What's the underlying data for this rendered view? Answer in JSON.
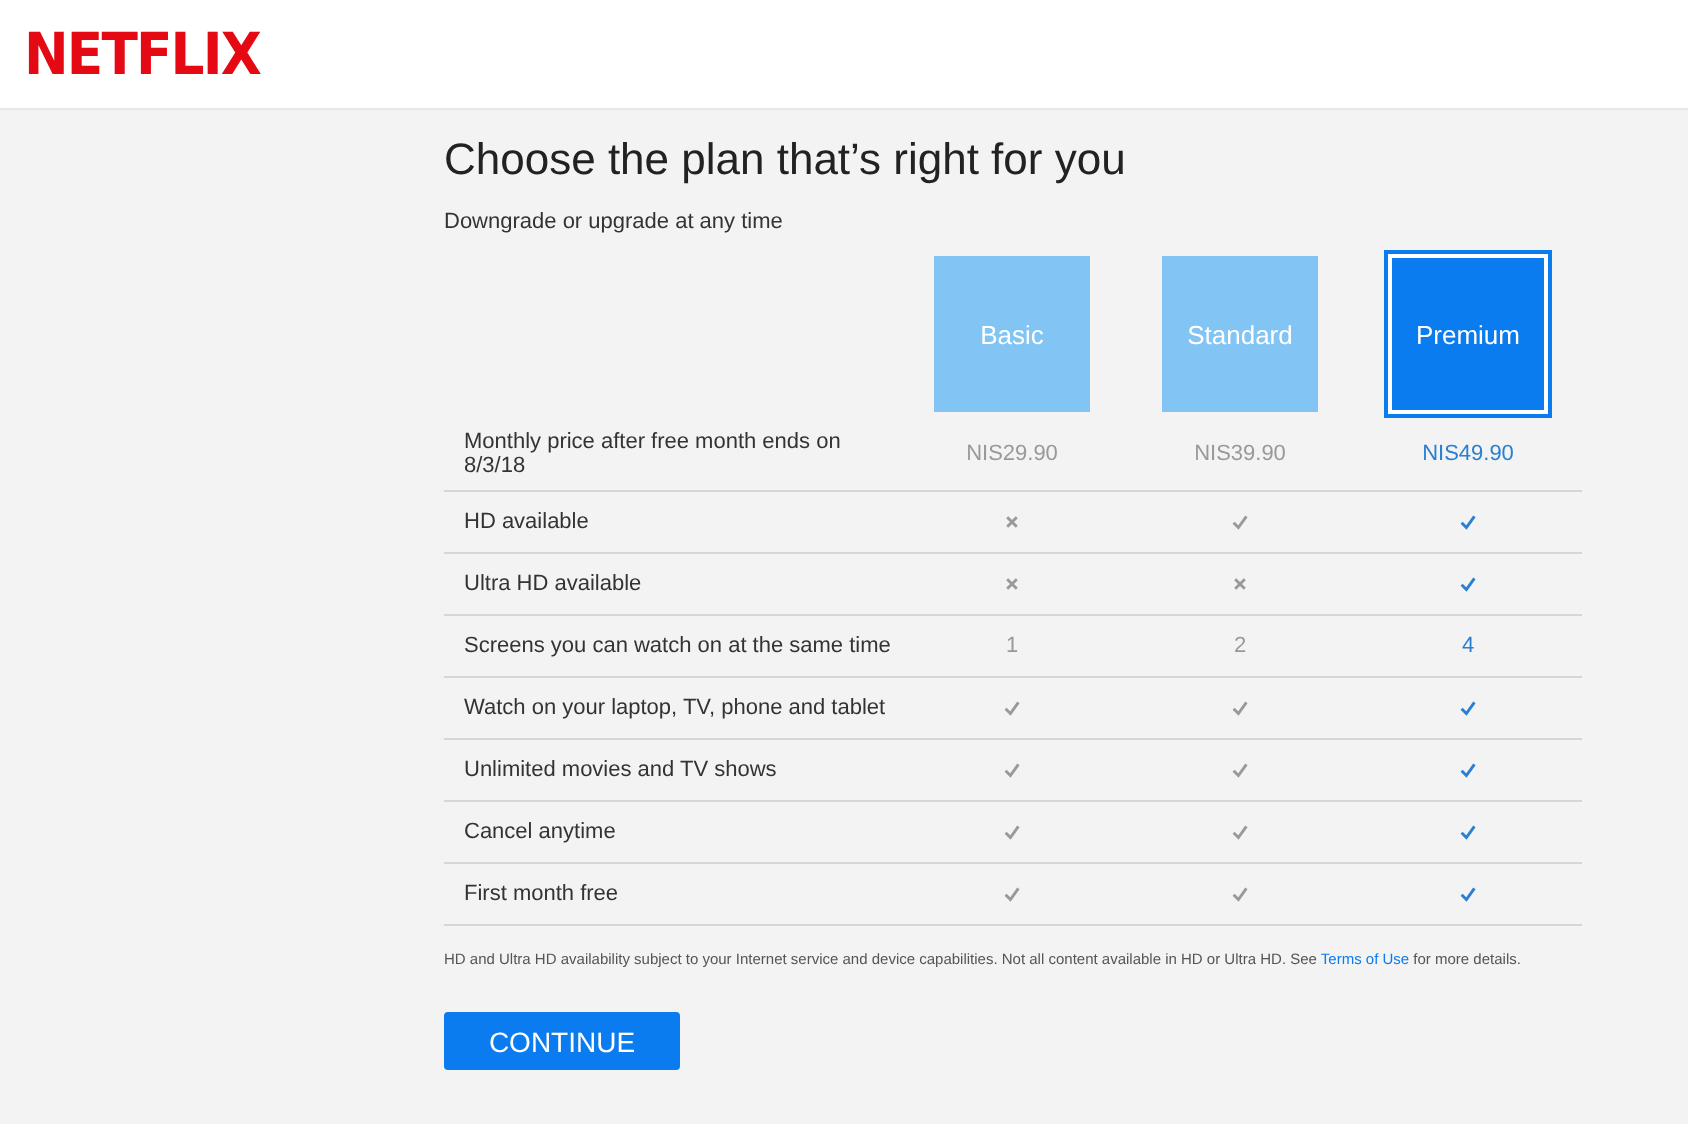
{
  "logo": "NETFLIX",
  "title": "Choose the plan that’s right for you",
  "subtitle": "Downgrade or upgrade at any time",
  "plans": [
    {
      "label": "Basic",
      "selected": false
    },
    {
      "label": "Standard",
      "selected": false
    },
    {
      "label": "Premium",
      "selected": true
    }
  ],
  "rows": [
    {
      "label": "Monthly price after free month ends on 8/3/18",
      "cells": [
        {
          "kind": "text",
          "text": "NIS29.90"
        },
        {
          "kind": "text",
          "text": "NIS39.90"
        },
        {
          "kind": "text",
          "text": "NIS49.90"
        }
      ]
    },
    {
      "label": "HD available",
      "cells": [
        {
          "kind": "cross"
        },
        {
          "kind": "check"
        },
        {
          "kind": "check"
        }
      ]
    },
    {
      "label": "Ultra HD available",
      "cells": [
        {
          "kind": "cross"
        },
        {
          "kind": "cross"
        },
        {
          "kind": "check"
        }
      ]
    },
    {
      "label": "Screens you can watch on at the same time",
      "cells": [
        {
          "kind": "text",
          "text": "1"
        },
        {
          "kind": "text",
          "text": "2"
        },
        {
          "kind": "text",
          "text": "4"
        }
      ]
    },
    {
      "label": "Watch on your laptop, TV, phone and tablet",
      "cells": [
        {
          "kind": "check"
        },
        {
          "kind": "check"
        },
        {
          "kind": "check"
        }
      ]
    },
    {
      "label": "Unlimited movies and TV shows",
      "cells": [
        {
          "kind": "check"
        },
        {
          "kind": "check"
        },
        {
          "kind": "check"
        }
      ]
    },
    {
      "label": "Cancel anytime",
      "cells": [
        {
          "kind": "check"
        },
        {
          "kind": "check"
        },
        {
          "kind": "check"
        }
      ]
    },
    {
      "label": "First month free",
      "cells": [
        {
          "kind": "check"
        },
        {
          "kind": "check"
        },
        {
          "kind": "check"
        }
      ]
    }
  ],
  "footnote": {
    "before": "HD and Ultra HD availability subject to your Internet service and device capabilities. Not all content available in HD or Ultra HD. See ",
    "link": "Terms of Use",
    "after": " for more details."
  },
  "button": "CONTINUE"
}
